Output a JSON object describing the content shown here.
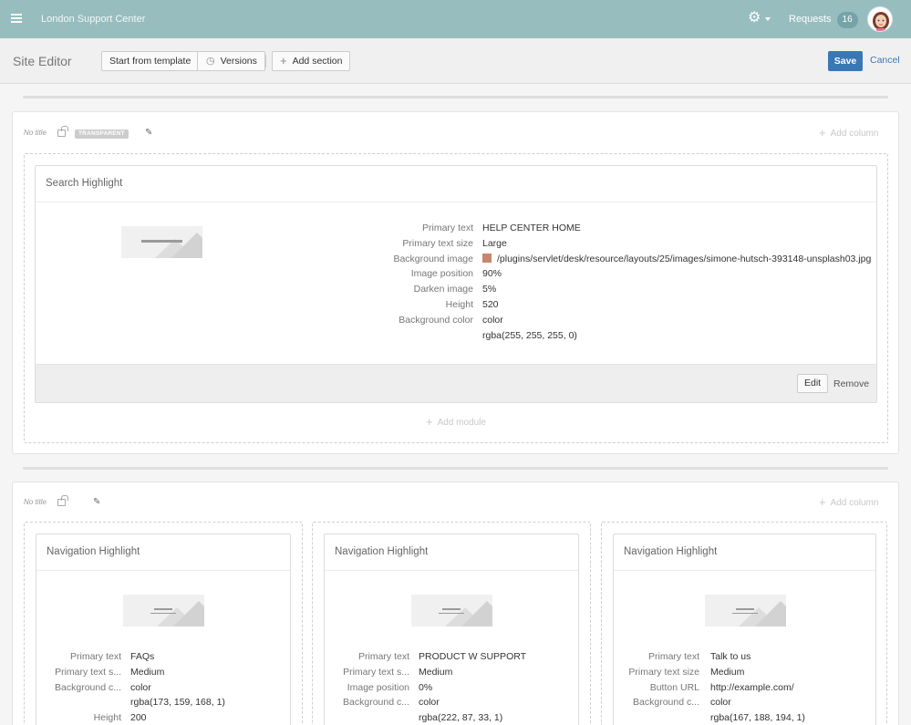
{
  "header": {
    "app_title": "London Support Center",
    "requests_label": "Requests",
    "requests_count": "16"
  },
  "toolbar": {
    "title": "Site Editor",
    "start_from_template": "Start from template",
    "versions": "Versions",
    "add_section": "Add section",
    "save": "Save",
    "cancel": "Cancel"
  },
  "sections": [
    {
      "title": "No title",
      "tag": "TRANSPARENT",
      "add_column": "Add column",
      "add_module": "Add module",
      "module": {
        "title": "Search Highlight",
        "props": [
          {
            "key": "Primary text",
            "value": "HELP CENTER HOME"
          },
          {
            "key": "Primary text size",
            "value": "Large"
          },
          {
            "key": "Background image",
            "value": "/plugins/servlet/desk/resource/layouts/25/images/simone-hutsch-393148-unsplash03.jpg"
          },
          {
            "key": "Image position",
            "value": "90%"
          },
          {
            "key": "Darken image",
            "value": "5%"
          },
          {
            "key": "Height",
            "value": "520"
          },
          {
            "key": "Background color",
            "value": "color"
          },
          {
            "key": "",
            "value": "rgba(255, 255, 255, 0)"
          }
        ],
        "edit": "Edit",
        "remove": "Remove"
      }
    },
    {
      "title": "No title",
      "add_column": "Add column",
      "modules": [
        {
          "title": "Navigation Highlight",
          "props": [
            {
              "key": "Primary text",
              "value": "FAQs"
            },
            {
              "key": "Primary text s...",
              "value": "Medium"
            },
            {
              "key": "Background c...",
              "value": "color"
            },
            {
              "key": "",
              "value": "rgba(173, 159, 168, 1)"
            },
            {
              "key": "Height",
              "value": "200"
            }
          ]
        },
        {
          "title": "Navigation Highlight",
          "props": [
            {
              "key": "Primary text",
              "value": "PRODUCT W SUPPORT"
            },
            {
              "key": "Primary text s...",
              "value": "Medium"
            },
            {
              "key": "Image position",
              "value": "0%"
            },
            {
              "key": "Background c...",
              "value": "color"
            },
            {
              "key": "",
              "value": "rgba(222, 87, 33, 1)"
            }
          ]
        },
        {
          "title": "Navigation Highlight",
          "props": [
            {
              "key": "Primary text",
              "value": "Talk to us"
            },
            {
              "key": "Primary text size",
              "value": "Medium"
            },
            {
              "key": "Button URL",
              "value": "http://example.com/"
            },
            {
              "key": "Background c...",
              "value": "color"
            },
            {
              "key": "",
              "value": "rgba(167, 188, 194, 1)"
            }
          ]
        }
      ]
    }
  ],
  "icons": {
    "menu": "hamburger-icon",
    "settings": "gear-icon",
    "versions": "clock-icon",
    "add": "plus-icon",
    "lock": "unlock-icon",
    "edit": "pencil-icon"
  },
  "colors": {
    "topbar": "#97bdbf",
    "primary": "#3a77b5"
  }
}
